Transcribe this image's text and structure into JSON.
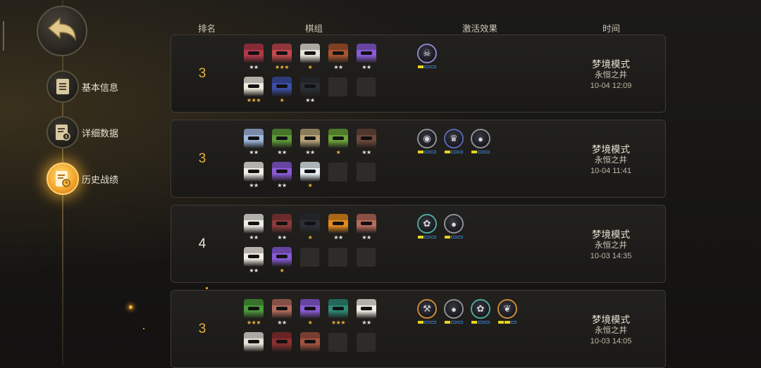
{
  "header": {
    "rank": "排名",
    "lineup": "棋组",
    "effects": "激活效果",
    "time": "时间"
  },
  "sidebar": {
    "items": [
      {
        "label": "基本信息",
        "icon": "clipboard-icon",
        "active": false
      },
      {
        "label": "详细数据",
        "icon": "data-sheet-icon",
        "active": false
      },
      {
        "label": "历史战绩",
        "icon": "history-icon",
        "active": true
      }
    ]
  },
  "colors": {
    "accent": "#f2a12a",
    "rank_gold": "#e9b23a",
    "rank_white": "#e8e2d4",
    "synergy_on": "#e8d21c"
  },
  "records": [
    {
      "rank": "3",
      "rank_color": "gold",
      "mode": "梦境模式",
      "map": "永恒之井",
      "date": "10-04 12:09",
      "pieces": [
        {
          "stars": "★★",
          "star_color": "white",
          "color": "#b23a4a"
        },
        {
          "stars": "★★★",
          "star_color": "gold",
          "color": "#c2494e"
        },
        {
          "stars": "★",
          "star_color": "gold",
          "color": "#e6e2d8"
        },
        {
          "stars": "★★",
          "star_color": "white",
          "color": "#a8552f"
        },
        {
          "stars": "★★",
          "star_color": "white",
          "color": "#8a5bd6"
        },
        {
          "stars": "★★★",
          "star_color": "gold",
          "color": "#efe9dd"
        },
        {
          "stars": "★",
          "star_color": "gold",
          "color": "#3d4fa6"
        },
        {
          "stars": "★★",
          "star_color": "white",
          "color": "#2b2f36"
        }
      ],
      "synergies": [
        {
          "icon": "fish-skeleton-icon",
          "glyph": "☠",
          "border": "#8b87c9",
          "level": 1
        }
      ]
    },
    {
      "rank": "3",
      "rank_color": "gold",
      "mode": "梦境模式",
      "map": "永恒之井",
      "date": "10-04 11:41",
      "pieces": [
        {
          "stars": "★★",
          "star_color": "white",
          "color": "#9fb8de"
        },
        {
          "stars": "★★",
          "star_color": "white",
          "color": "#5f9a3a"
        },
        {
          "stars": "★★",
          "star_color": "white",
          "color": "#b9a47a"
        },
        {
          "stars": "★",
          "star_color": "gold",
          "color": "#6aa43a"
        },
        {
          "stars": "★★",
          "star_color": "white",
          "color": "#6b4a3c"
        },
        {
          "stars": "★★",
          "star_color": "white",
          "color": "#f1ece4"
        },
        {
          "stars": "★★",
          "star_color": "white",
          "color": "#8a5bd6"
        },
        {
          "stars": "★",
          "star_color": "gold",
          "color": "#e7f0f4"
        }
      ],
      "synergies": [
        {
          "icon": "goblin-icon",
          "glyph": "◉",
          "border": "#8d8f96",
          "level": 1
        },
        {
          "icon": "demon-icon",
          "glyph": "♛",
          "border": "#5b67b0",
          "level": 1
        },
        {
          "icon": "human-icon",
          "glyph": "●",
          "border": "#8d8f96",
          "level": 1
        }
      ]
    },
    {
      "rank": "4",
      "rank_color": "white",
      "mode": "梦境模式",
      "map": "永恒之井",
      "date": "10-03 14:35",
      "pieces": [
        {
          "stars": "★★",
          "star_color": "white",
          "color": "#ecebe4"
        },
        {
          "stars": "★★",
          "star_color": "white",
          "color": "#8c3a3a"
        },
        {
          "stars": "★",
          "star_color": "gold",
          "color": "#2b2f36"
        },
        {
          "stars": "★★",
          "star_color": "white",
          "color": "#e38a1f"
        },
        {
          "stars": "★★",
          "star_color": "white",
          "color": "#b86b5a"
        },
        {
          "stars": "★★",
          "star_color": "white",
          "color": "#f3eee5"
        },
        {
          "stars": "★",
          "star_color": "gold",
          "color": "#8a5bd6"
        }
      ],
      "synergies": [
        {
          "icon": "beast-paw-icon",
          "glyph": "✿",
          "border": "#4fa89a",
          "level": 1
        },
        {
          "icon": "human-icon",
          "glyph": "●",
          "border": "#8d8f96",
          "level": 1
        }
      ]
    },
    {
      "rank": "3",
      "rank_color": "gold",
      "mode": "梦境模式",
      "map": "永恒之井",
      "date": "10-03 14:05",
      "pieces": [
        {
          "stars": "★★★",
          "star_color": "gold",
          "color": "#4a9a3a"
        },
        {
          "stars": "★★",
          "star_color": "white",
          "color": "#b06a5c"
        },
        {
          "stars": "★",
          "star_color": "gold",
          "color": "#8a5bd6"
        },
        {
          "stars": "★★★",
          "star_color": "gold",
          "color": "#2e8a76"
        },
        {
          "stars": "★★",
          "star_color": "white",
          "color": "#f0ebe2"
        },
        {
          "stars": "",
          "star_color": "white",
          "color": "#e6e1d8"
        },
        {
          "stars": "",
          "star_color": "white",
          "color": "#8c2f2f"
        },
        {
          "stars": "",
          "star_color": "white",
          "color": "#a0523f"
        }
      ],
      "synergies": [
        {
          "icon": "warrior-axe-icon",
          "glyph": "⚒",
          "border": "#c98a3a",
          "level": 1
        },
        {
          "icon": "human-icon",
          "glyph": "●",
          "border": "#8d8f96",
          "level": 1
        },
        {
          "icon": "beast-paw-icon",
          "glyph": "✿",
          "border": "#4fa89a",
          "level": 1
        },
        {
          "icon": "feather-icon",
          "glyph": "❦",
          "border": "#c98a3a",
          "level": 2
        }
      ]
    }
  ]
}
